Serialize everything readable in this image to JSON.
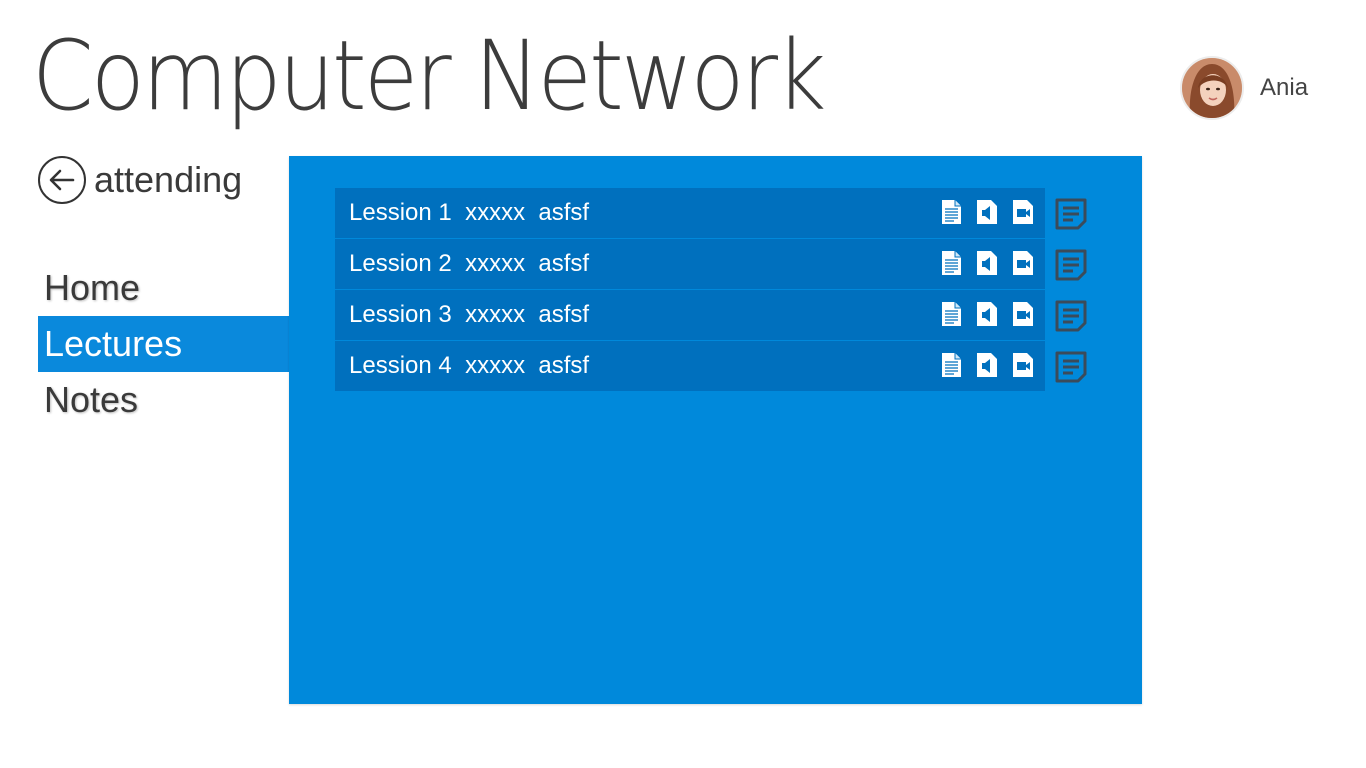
{
  "header": {
    "title": "Computer Network",
    "user_name": "Ania"
  },
  "back": {
    "label": "attending",
    "icon": "arrow-left-circle-icon"
  },
  "nav": {
    "items": [
      {
        "label": "Home",
        "selected": false
      },
      {
        "label": "Lectures",
        "selected": true
      },
      {
        "label": "Notes",
        "selected": false
      }
    ]
  },
  "lessons": [
    {
      "label": "Lession 1  xxxxx  asfsf"
    },
    {
      "label": "Lession 2  xxxxx  asfsf"
    },
    {
      "label": "Lession 3  xxxxx  asfsf"
    },
    {
      "label": "Lession 4  xxxxx  asfsf"
    }
  ],
  "lesson_icons": [
    "document-icon",
    "audio-icon",
    "video-icon",
    "note-icon"
  ],
  "colors": {
    "accent": "#0089db",
    "row": "#0070be",
    "nav_selected": "#0a89dc"
  }
}
